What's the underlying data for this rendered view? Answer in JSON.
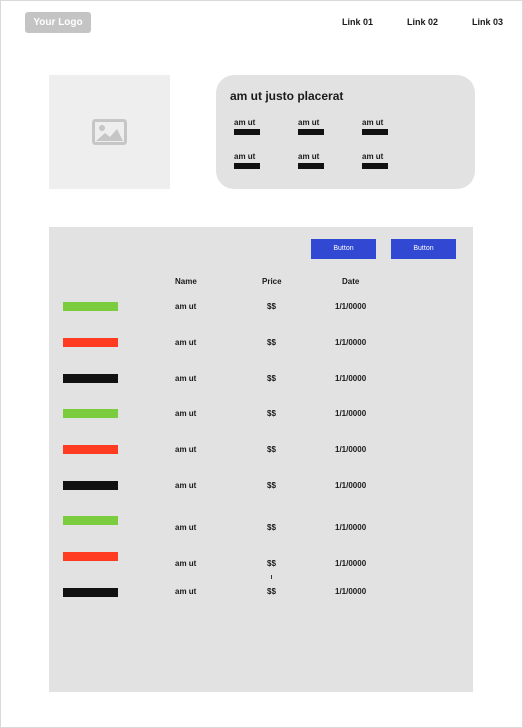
{
  "header": {
    "logo_label": "Your Logo",
    "links": [
      "Link 01",
      "Link 02",
      "Link 03"
    ]
  },
  "image_placeholder": {
    "icon": "image-icon"
  },
  "info_card": {
    "title": "am ut justo placerat",
    "items": [
      "am ut",
      "am ut",
      "am ut",
      "am ut",
      "am ut",
      "am ut"
    ]
  },
  "table": {
    "buttons": [
      "Button",
      "Button"
    ],
    "headers": {
      "name": "Name",
      "price": "Price",
      "date": "Date"
    },
    "rows": [
      {
        "status_color": "#7ccc3f",
        "name": "am ut",
        "price": "$$",
        "date": "1/1/0000"
      },
      {
        "status_color": "#ff3b21",
        "name": "am ut",
        "price": "$$",
        "date": "1/1/0000"
      },
      {
        "status_color": "#111111",
        "name": "am ut",
        "price": "$$",
        "date": "1/1/0000"
      },
      {
        "status_color": "#7ccc3f",
        "name": "am ut",
        "price": "$$",
        "date": "1/1/0000"
      },
      {
        "status_color": "#ff3b21",
        "name": "am ut",
        "price": "$$",
        "date": "1/1/0000"
      },
      {
        "status_color": "#111111",
        "name": "am ut",
        "price": "$$",
        "date": "1/1/0000"
      },
      {
        "status_color": "#7ccc3f",
        "name": "am ut",
        "price": "$$",
        "date": "1/1/0000"
      },
      {
        "status_color": "#ff3b21",
        "name": "am ut",
        "price": "$$",
        "date": "1/1/0000"
      },
      {
        "status_color": "#111111",
        "name": "am ut",
        "price": "$$",
        "date": "1/1/0000"
      }
    ]
  },
  "colors": {
    "button": "#3048d2",
    "panel": "#e2e2e2",
    "status_green": "#7ccc3f",
    "status_red": "#ff3b21",
    "status_black": "#111111"
  }
}
